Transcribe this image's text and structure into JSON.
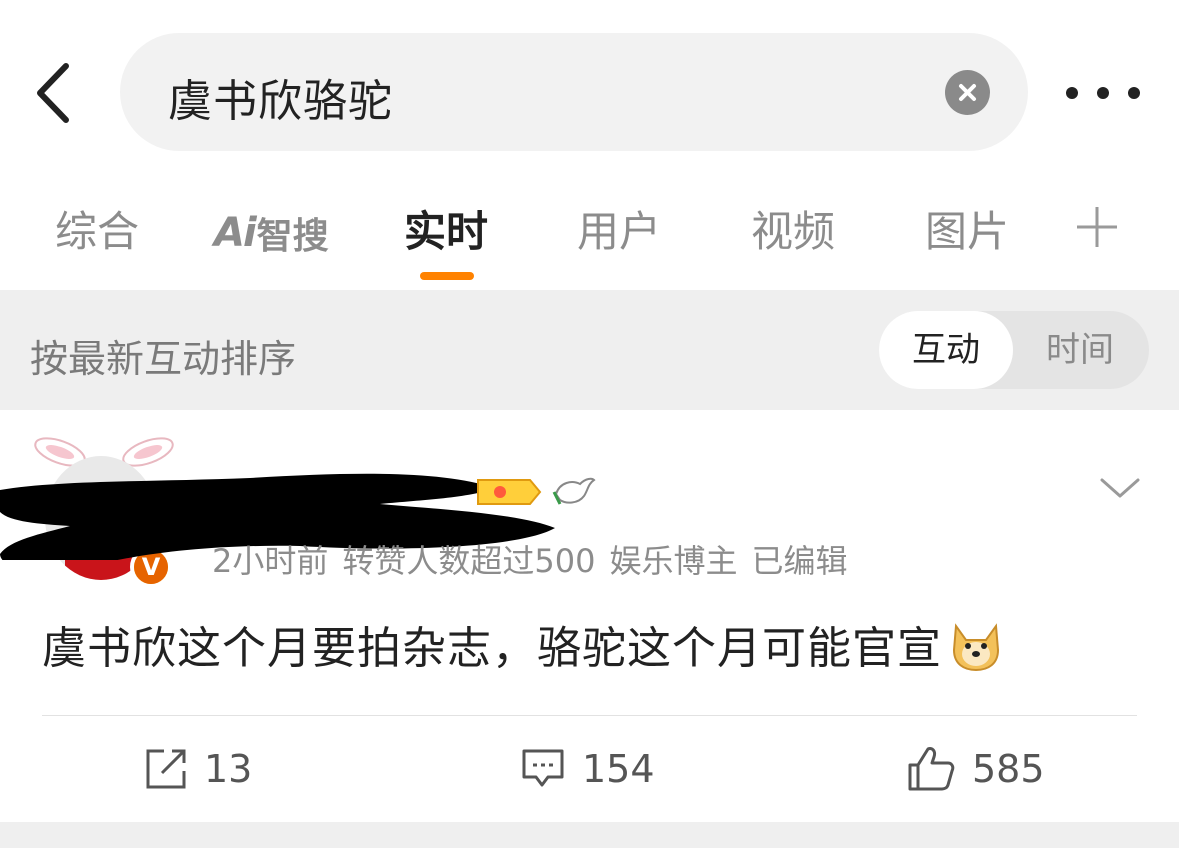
{
  "search": {
    "query": "虞书欣骆驼"
  },
  "tabs": [
    {
      "label": "综合"
    },
    {
      "label": "Ai",
      "label2": "智搜"
    },
    {
      "label": "实时"
    },
    {
      "label": "用户"
    },
    {
      "label": "视频"
    },
    {
      "label": "图片"
    }
  ],
  "sort": {
    "label": "按最新互动排序",
    "options": [
      "互动",
      "时间"
    ],
    "selected": "互动"
  },
  "post": {
    "time": "2小时前",
    "repost_info": "转赞人数超过500",
    "author_tag": "娱乐博主",
    "edited": "已编辑",
    "content": "虞书欣这个月要拍杂志，骆驼这个月可能官宣",
    "reposts": "13",
    "comments": "154",
    "likes": "585"
  },
  "colors": {
    "accent": "#ff8200",
    "badge": "#ffb400",
    "muted": "#8c8c8c"
  },
  "icons": [
    "back-icon",
    "clear-icon",
    "more-icon",
    "add-tab-icon",
    "vip-badge-icon",
    "dove-icon",
    "chevron-down-icon",
    "doge-emoji-icon",
    "repost-icon",
    "comment-icon",
    "like-icon"
  ]
}
